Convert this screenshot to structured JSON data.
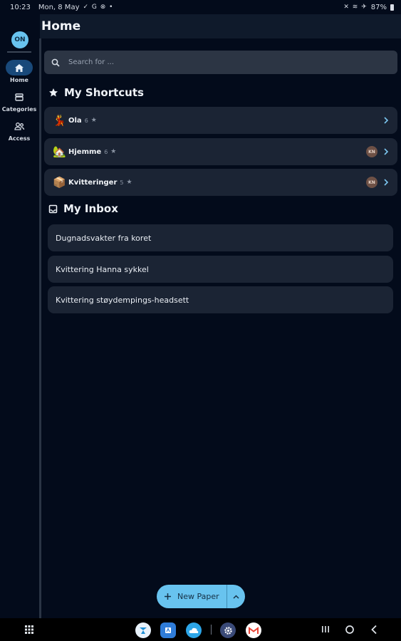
{
  "status_bar": {
    "time": "10:23",
    "date": "Mon, 8 May",
    "left_icons": "✓ G ⊗ •",
    "battery": "87%",
    "right_icons": "✕ ≋ ✈"
  },
  "header": {
    "title": "Home"
  },
  "nav_rail": {
    "avatar_initials": "ON",
    "items": [
      {
        "label": "Home",
        "icon": "home-icon",
        "active": true
      },
      {
        "label": "Categories",
        "icon": "categories-icon",
        "active": false
      },
      {
        "label": "Access",
        "icon": "access-icon",
        "active": false
      }
    ]
  },
  "search": {
    "placeholder": "Search for ..."
  },
  "shortcuts": {
    "title": "My Shortcuts",
    "items": [
      {
        "emoji": "💃",
        "name": "Ola",
        "count": "6",
        "star": "★",
        "user_initials": ""
      },
      {
        "emoji": "🏡",
        "name": "Hjemme",
        "count": "6",
        "star": "★",
        "user_initials": "KN"
      },
      {
        "emoji": "📦",
        "name": "Kvitteringer",
        "count": "5",
        "star": "★",
        "user_initials": "KN"
      }
    ]
  },
  "inbox": {
    "title": "My Inbox",
    "items": [
      "Dugnadsvakter fra koret",
      "Kvittering Hanna sykkel",
      "Kvittering støydempings-headsett"
    ]
  },
  "fab": {
    "label": "New Paper"
  },
  "colors": {
    "background": "#030b1b",
    "card": "#1b2434",
    "accent": "#68c3ef",
    "active_nav": "#19497a"
  }
}
